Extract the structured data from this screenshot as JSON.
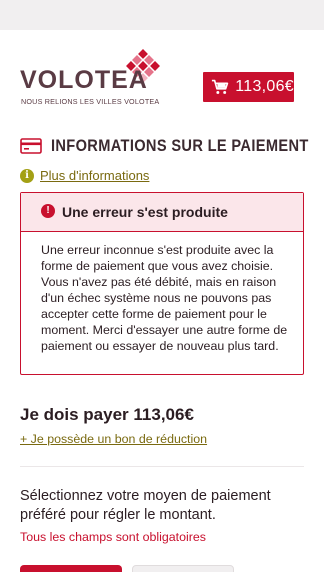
{
  "header": {
    "logo_text": "VOLOTEA",
    "logo_tagline": "NOUS RELIONS LES VILLES VOLOTEA",
    "cart_price": "113,06€",
    "brand_color": "#c8102e"
  },
  "payment": {
    "section_title": "INFORMATIONS SUR LE PAIEMENT",
    "more_info_link": "Plus d'informations",
    "error": {
      "title": "Une erreur s'est produite",
      "message": "Une erreur inconnue s'est produite avec la forme de paiement que vous avez choisie. Vous n'avez pas été débité, mais en raison d'un échec système nous ne pouvons pas accepter cette forme de paiement pour le moment. Merci d'essayer une autre forme de paiement ou essayer de nouveau plus tard."
    },
    "amount_label": "Je dois payer 113,06€",
    "voucher_link": "+ Je possède un bon de réduction",
    "select_method_text": "Sélectionnez votre moyen de paiement préféré pour régler le montant.",
    "required_note": "Tous les champs sont obligatoires"
  },
  "icons": {
    "cart": "shopping-cart-icon",
    "card": "credit-card-icon",
    "info": "info-icon",
    "warning": "exclamation-icon"
  }
}
